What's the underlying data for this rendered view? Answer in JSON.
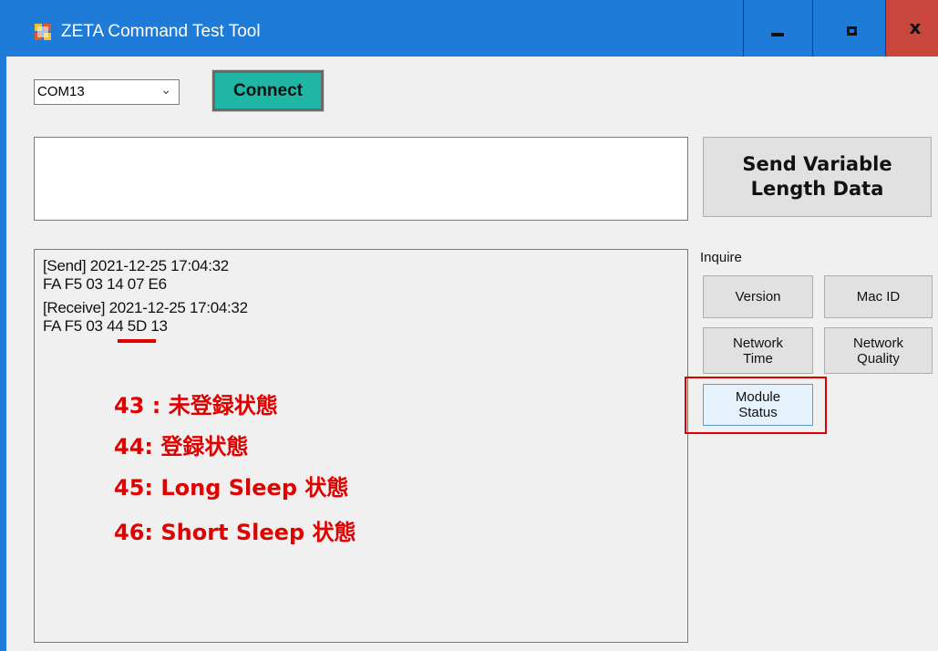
{
  "window": {
    "title": "ZETA Command Test Tool",
    "close_label": "x",
    "accent_color": "#1e7bd8"
  },
  "port": {
    "selected": "COM13"
  },
  "connect": {
    "label": "Connect",
    "color": "#1fb6a6"
  },
  "send": {
    "input_value": "",
    "button_line1": "Send Variable",
    "button_line2": "Length Data"
  },
  "log": {
    "lines": [
      "[Send] 2021-12-25 17:04:32",
      "FA F5 03 14 07 E6",
      "[Receive] 2021-12-25 17:04:32",
      "FA F5 03 44 5D 13"
    ]
  },
  "annotations": {
    "color": "#e00000",
    "items": [
      "43 : 未登録状態",
      "44:  登録状態",
      "45:  Long Sleep 状態",
      "46:  Short Sleep 状態"
    ]
  },
  "inquire": {
    "label": "Inquire",
    "version": "Version",
    "mac_id": "Mac ID",
    "network_time_1": "Network",
    "network_time_2": "Time",
    "network_quality_1": "Network",
    "network_quality_2": "Quality",
    "module_status_1": "Module",
    "module_status_2": "Status"
  }
}
